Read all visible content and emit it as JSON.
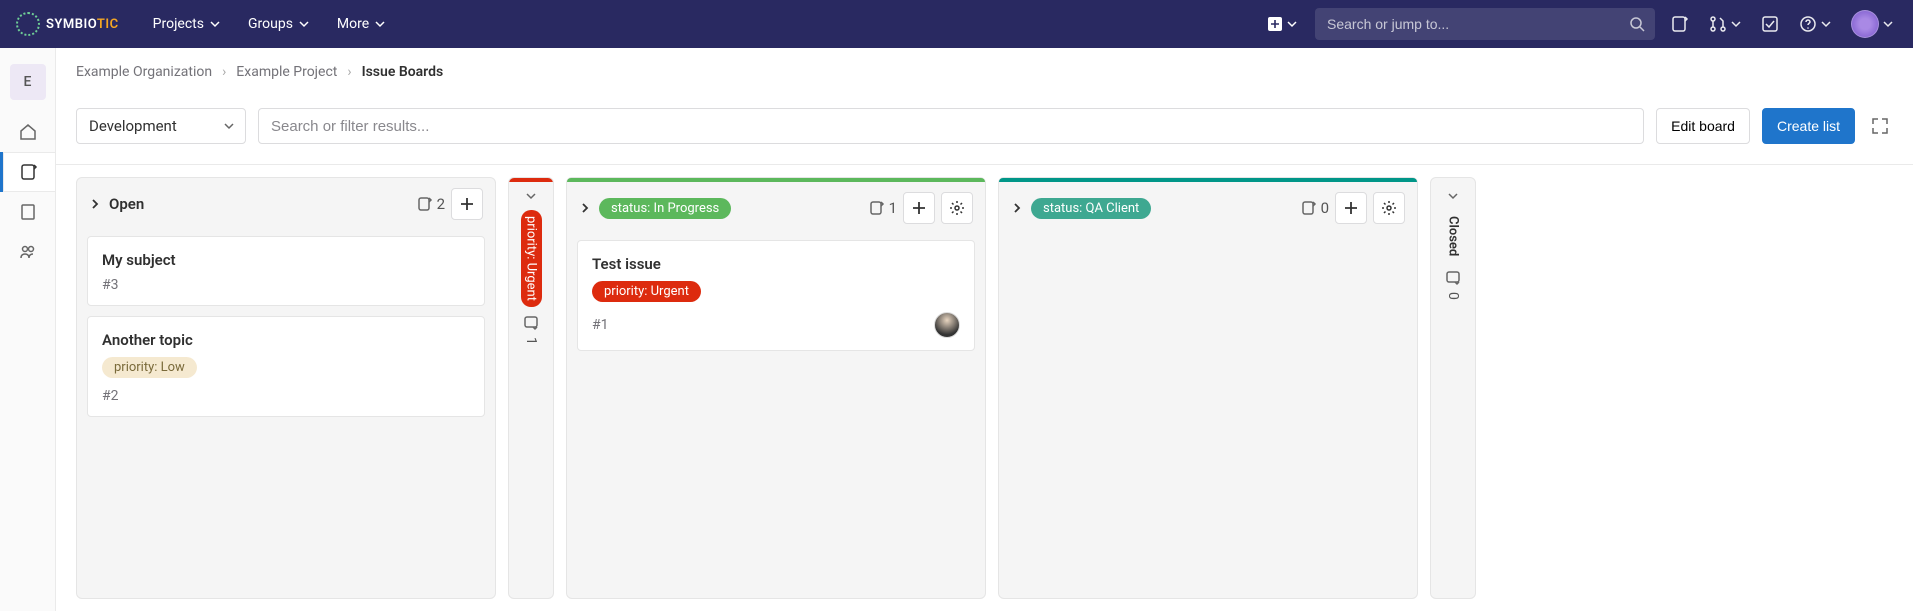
{
  "brand": {
    "name_a": "SYMBIO",
    "name_b": "TIC"
  },
  "nav": {
    "items": [
      {
        "label": "Projects"
      },
      {
        "label": "Groups"
      },
      {
        "label": "More"
      }
    ],
    "search_placeholder": "Search or jump to..."
  },
  "breadcrumbs": {
    "org": "Example Organization",
    "project": "Example Project",
    "current": "Issue Boards"
  },
  "sidebar": {
    "project_initial": "E"
  },
  "toolbar": {
    "board_name": "Development",
    "filter_placeholder": "Search or filter results...",
    "edit_label": "Edit board",
    "create_label": "Create list"
  },
  "columns": {
    "open": {
      "title": "Open",
      "count": "2",
      "cards": [
        {
          "title": "My subject",
          "id": "#3"
        },
        {
          "title": "Another topic",
          "id": "#2",
          "label": "priority: Low"
        }
      ]
    },
    "urgent_collapsed": {
      "label": "priority: Urgent",
      "count": "1"
    },
    "in_progress": {
      "label": "status: In Progress",
      "count": "1",
      "cards": [
        {
          "title": "Test issue",
          "id": "#1",
          "label": "priority: Urgent"
        }
      ]
    },
    "qa": {
      "label": "status: QA Client",
      "count": "0"
    },
    "closed_collapsed": {
      "label": "Closed",
      "count": "0"
    }
  }
}
